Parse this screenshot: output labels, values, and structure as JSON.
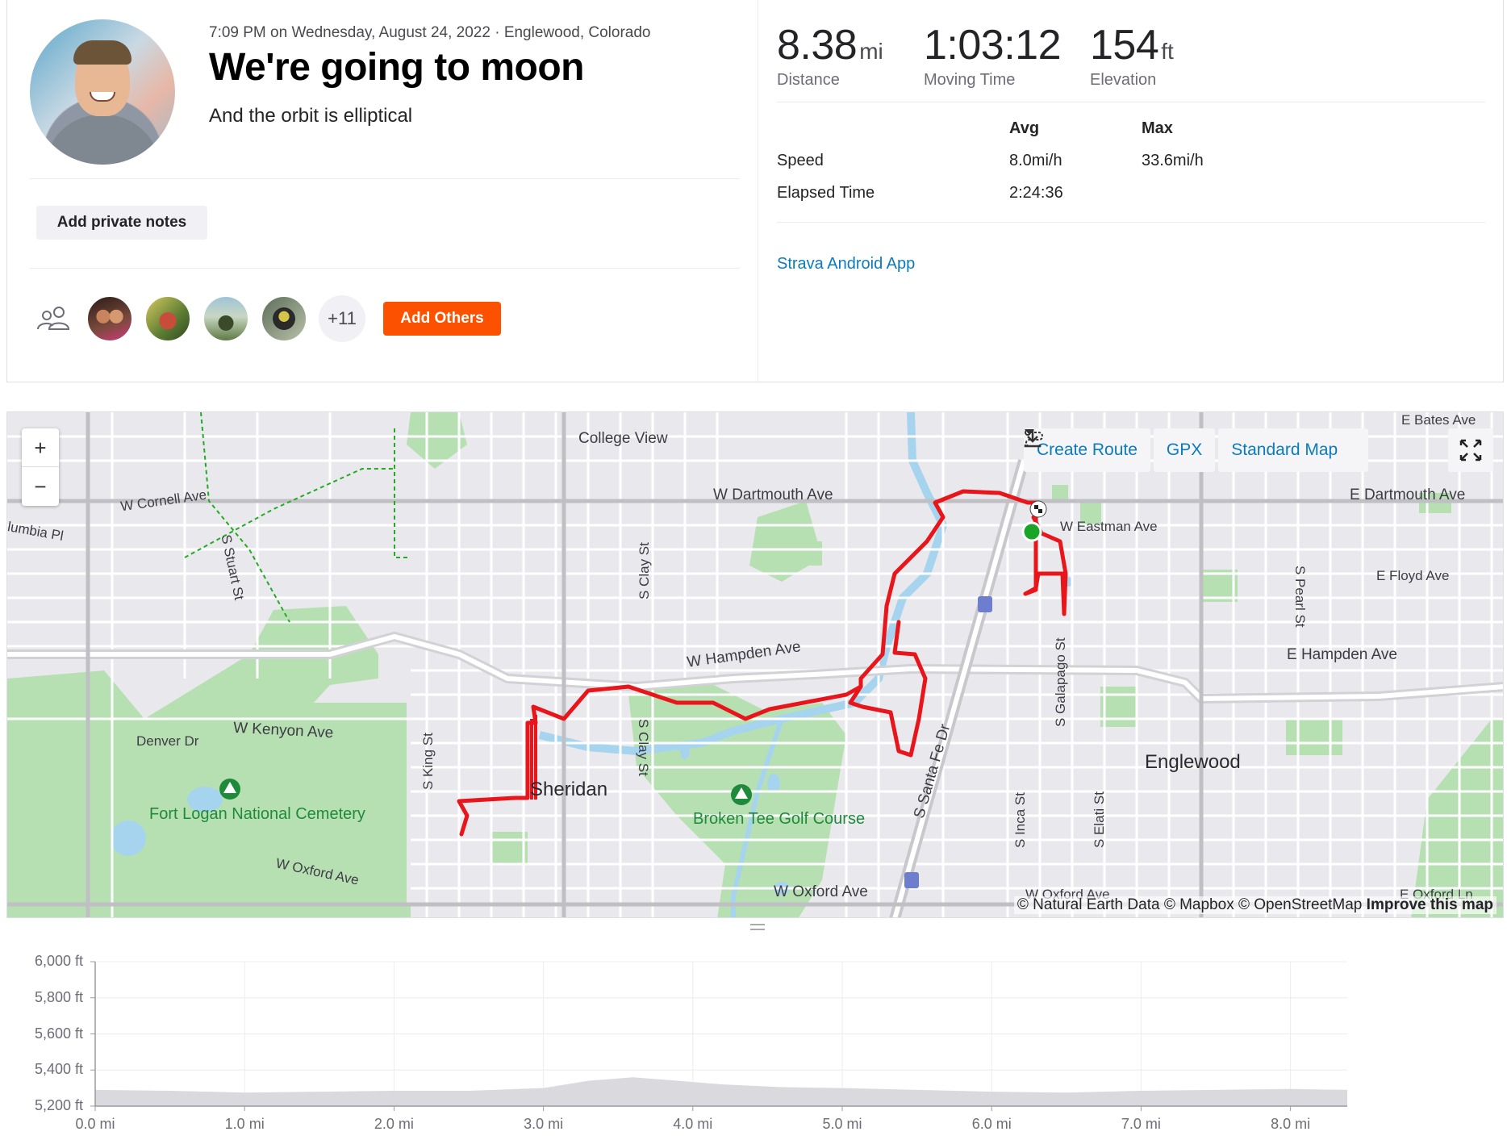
{
  "activity": {
    "meta": "7:09 PM on Wednesday, August 24, 2022 · Englewood, Colorado",
    "title": "We're going to moon",
    "description": "And the orbit is elliptical",
    "private_notes_label": "Add private notes",
    "others_count": "+11",
    "add_others_label": "Add Others"
  },
  "stats": {
    "distance": {
      "value": "8.38",
      "unit": "mi",
      "label": "Distance"
    },
    "moving_time": {
      "value": "1:03:12",
      "label": "Moving Time"
    },
    "elevation": {
      "value": "154",
      "unit": "ft",
      "label": "Elevation"
    },
    "table": {
      "headers": [
        "Avg",
        "Max"
      ],
      "rows": [
        {
          "label": "Speed",
          "avg": "8.0mi/h",
          "max": "33.6mi/h"
        },
        {
          "label": "Elapsed Time",
          "avg": "2:24:36",
          "max": ""
        }
      ]
    },
    "device": "Strava Android App"
  },
  "map": {
    "toolbar": {
      "create_route": "Create Route",
      "gpx": "GPX",
      "map_style": "Standard Map"
    },
    "zoom_in": "+",
    "zoom_out": "−",
    "attribution": "© Natural Earth Data © Mapbox © OpenStreetMap",
    "improve": "Improve this map",
    "labels": {
      "college_view": "College View",
      "w_dartmouth": "W Dartmouth Ave",
      "e_dartmouth": "E Dartmouth Ave",
      "w_cornell": "W Cornell Ave",
      "columbia": "lumbia Pl",
      "s_stuart": "S Stuart St",
      "s_clay_n": "S Clay St",
      "s_clay_s": "S Clay St",
      "w_eastman": "W Eastman Ave",
      "e_floyd": "E Floyd Ave",
      "s_pearl": "S Pearl St",
      "w_hampden": "W Hampden Ave",
      "e_hampden": "E Hampden Ave",
      "s_galapago": "S Galapago St",
      "w_kenyon": "W Kenyon Ave",
      "denver_dr": "Denver Dr",
      "s_king": "S King St",
      "sheridan": "Sheridan",
      "englewood": "Englewood",
      "s_santa_fe": "S Santa Fe Dr",
      "s_inca": "S Inca St",
      "s_elati": "S Elati St",
      "w_oxford_l": "W Oxford Ave",
      "w_oxford_c": "W Oxford Ave",
      "w_oxford_r": "W Oxford Ave",
      "e_oxford": "E Oxford Ln",
      "e_bates": "E Bates Ave",
      "fort_logan": "Fort Logan National Cemetery",
      "broken_tee": "Broken Tee Golf Course",
      "s_pearl_s": "Pearl St"
    }
  },
  "elevation_chart": {
    "y_ticks": [
      "6,000 ft",
      "5,800 ft",
      "5,600 ft",
      "5,400 ft",
      "5,200 ft"
    ],
    "x_ticks": [
      "0.0 mi",
      "1.0 mi",
      "2.0 mi",
      "3.0 mi",
      "4.0 mi",
      "5.0 mi",
      "6.0 mi",
      "7.0 mi",
      "8.0 mi"
    ]
  },
  "chart_data": {
    "type": "area",
    "xlim": [
      0,
      8.38
    ],
    "ylim": [
      5200,
      6000
    ],
    "x": [
      0,
      0.5,
      1.0,
      1.5,
      2.0,
      2.5,
      3.0,
      3.3,
      3.6,
      3.9,
      4.2,
      4.6,
      5.0,
      5.5,
      6.0,
      6.5,
      7.0,
      7.5,
      8.0,
      8.38
    ],
    "values": [
      5290,
      5285,
      5275,
      5280,
      5285,
      5285,
      5300,
      5340,
      5360,
      5340,
      5320,
      5305,
      5300,
      5290,
      5280,
      5275,
      5285,
      5290,
      5295,
      5290
    ],
    "color": "#d9d9de"
  },
  "colors": {
    "brand": "#fc5200",
    "link": "#0a7bbf",
    "route": "#e8151b",
    "start": "#1aa528"
  }
}
